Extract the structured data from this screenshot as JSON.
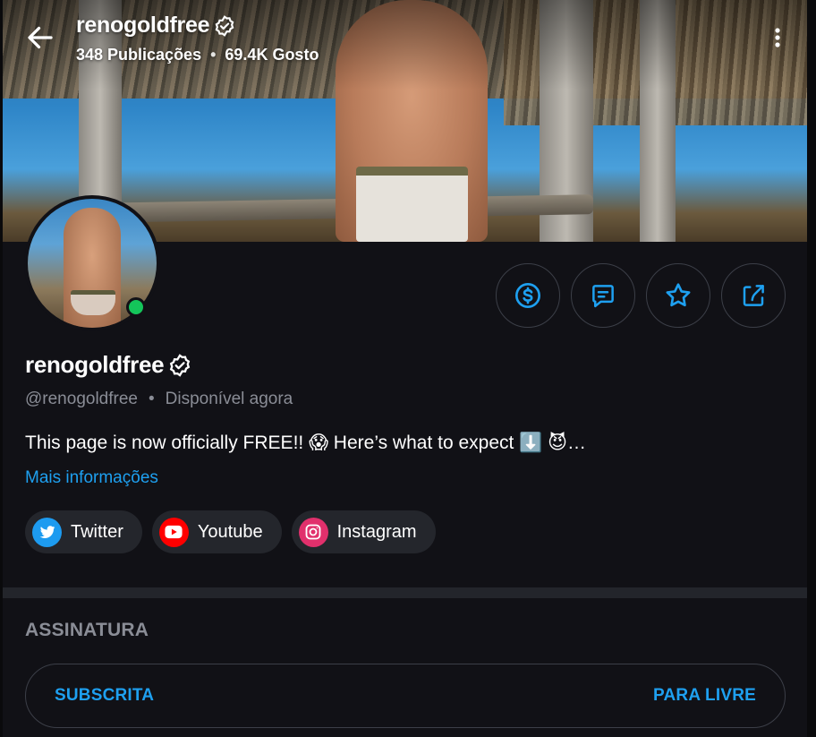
{
  "header": {
    "username": "renogoldfree",
    "posts_count": "348 Publicações",
    "likes_count": "69.4K Gosto",
    "separator": "•"
  },
  "icons": {
    "back": "arrow-left-icon",
    "verified": "verified-badge-icon",
    "more": "more-vertical-icon",
    "tip": "dollar-circle-icon",
    "message": "message-icon",
    "favorite": "star-icon",
    "share": "share-icon"
  },
  "profile": {
    "display_name": "renogoldfree",
    "handle": "@renogoldfree",
    "separator": "•",
    "status": "Disponível agora",
    "bio": "This page is now officially FREE!! 😱  Here’s what to expect ⬇️ 😈…",
    "more_info": "Mais informações",
    "online": true
  },
  "socials": [
    {
      "label": "Twitter",
      "color": "#1d9bf0"
    },
    {
      "label": "Youtube",
      "color": "#ff0000"
    },
    {
      "label": "Instagram",
      "color": "#e1306c"
    }
  ],
  "subscription": {
    "section_title": "ASSINATURA",
    "status": "SUBSCRITA",
    "price": "PARA LIVRE"
  },
  "colors": {
    "accent": "#1ea0f0",
    "background": "#111116",
    "online": "#14c55a",
    "muted_text": "#8a8d96"
  }
}
